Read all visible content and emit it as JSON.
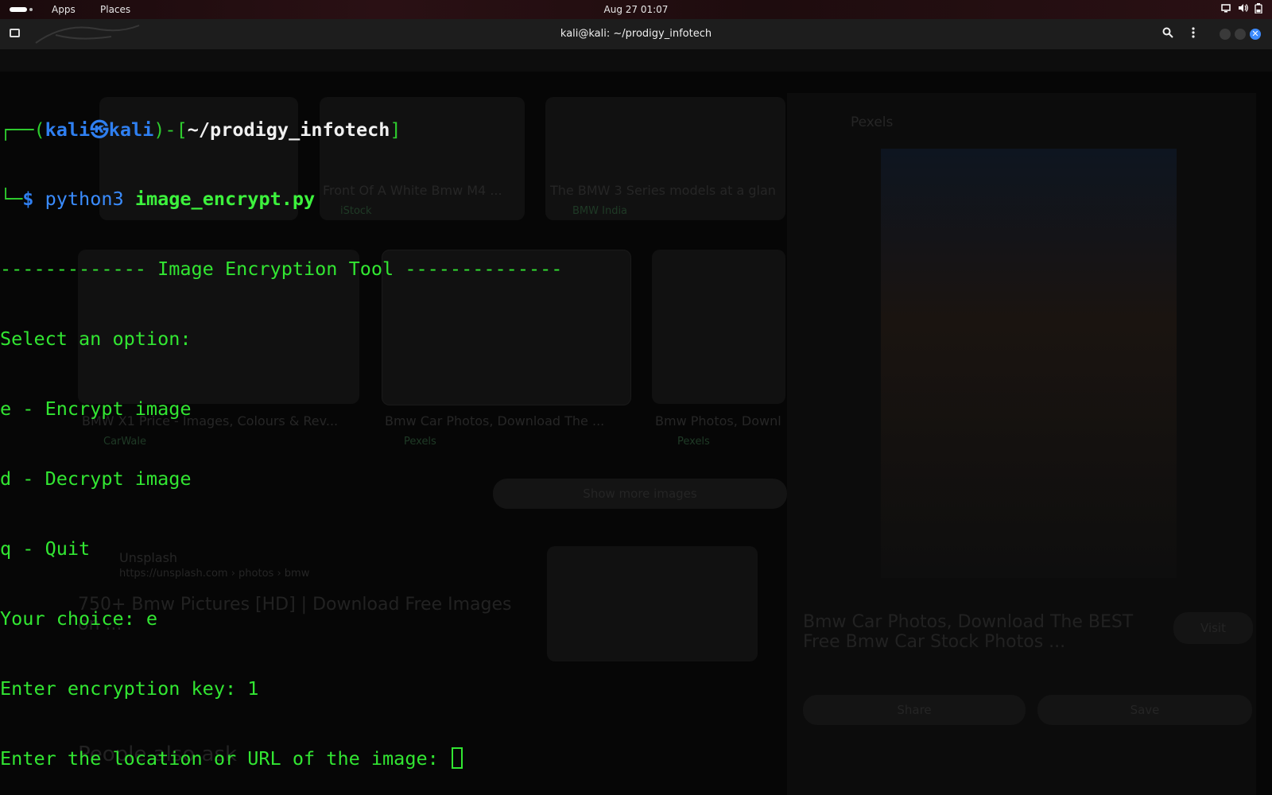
{
  "topbar": {
    "apps_label": "Apps",
    "places_label": "Places",
    "clock": "Aug 27  01:07"
  },
  "window": {
    "title": "kali@kali: ~/prodigy_infotech"
  },
  "prompt": {
    "open": "┌──(",
    "user": "kali",
    "at": "㉿",
    "host": "kali",
    "mid": ")-[",
    "path": "~/prodigy_infotech",
    "close": "]",
    "corner": "└─",
    "dollar": "$",
    "cmd": "python3",
    "arg": "image_encrypt.py"
  },
  "output": {
    "banner": "------------- Image Encryption Tool --------------",
    "select": "Select an option:",
    "opt_e": "e - Encrypt image",
    "opt_d": "d - Decrypt image",
    "opt_q": "q - Quit",
    "choice": "Your choice: e",
    "key": "Enter encryption key: 1",
    "location": "Enter the location or URL of the image: "
  },
  "background": {
    "captions": [
      "Front Of A White Bmw M4 ...",
      "The BMW 3 Series models at a glan",
      "BMW X1 Price - Images, Colours & Rev...",
      "Bmw Car Photos, Download The ...",
      "Bmw Photos, Downl"
    ],
    "sources": [
      "iStock",
      "BMW India",
      "CarWale",
      "Pexels",
      "Pexels"
    ],
    "show_more": "Show more images",
    "result_site": "Unsplash",
    "result_url": "https://unsplash.com › photos › bmw",
    "result_title": "750+ Bmw Pictures [HD] | Download Free Images on ...",
    "people_ask": "People also ask",
    "side_source": "Pexels",
    "side_title": "Bmw Car Photos, Download The BEST Free Bmw Car Stock Photos ...",
    "side_visit": "Visit",
    "side_share": "Share",
    "side_save": "Save"
  },
  "colors": {
    "prompt_blue": "#2f7ff0",
    "prompt_green": "#3df23d",
    "text_green": "#32e632",
    "cursor_green": "#32e632"
  }
}
